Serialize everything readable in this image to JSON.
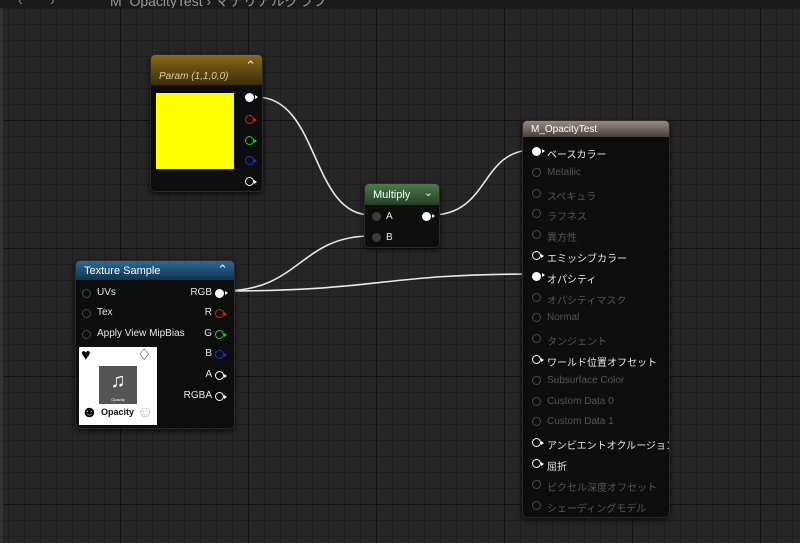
{
  "topbar": {
    "back": "‹",
    "forward": "›",
    "breadcrumb": "M_OpacityTest › マテリアルグラフ"
  },
  "param_node": {
    "title": "Param (1,1,0,0)",
    "color_hex": "#ffff00"
  },
  "multiply_node": {
    "title": "Multiply",
    "input_a": "A",
    "input_b": "B"
  },
  "texture_node": {
    "title": "Texture Sample",
    "inputs": [
      "UVs",
      "Tex",
      "Apply View MipBias"
    ],
    "outputs": [
      "RGB",
      "R",
      "G",
      "B",
      "A",
      "RGBA"
    ],
    "thumbnail_caption": "Opacity",
    "thumbnail_small": "Opacity"
  },
  "result_node": {
    "title": "M_OpacityTest",
    "pins": [
      {
        "label": "ベースカラー",
        "active": true
      },
      {
        "label": "Metallic",
        "active": false
      },
      {
        "label": "スペキュラ",
        "active": false
      },
      {
        "label": "ラフネス",
        "active": false
      },
      {
        "label": "異方性",
        "active": false
      },
      {
        "label": "エミッシブカラー",
        "active": true
      },
      {
        "label": "オパシティ",
        "active": true
      },
      {
        "label": "オパシティマスク",
        "active": false
      },
      {
        "label": "Normal",
        "active": false
      },
      {
        "label": "タンジェント",
        "active": false
      },
      {
        "label": "ワールド位置オフセット",
        "active": true
      },
      {
        "label": "Subsurface Color",
        "active": false
      },
      {
        "label": "Custom Data 0",
        "active": false
      },
      {
        "label": "Custom Data 1",
        "active": false
      },
      {
        "label": "アンビエントオクルージョン",
        "active": true
      },
      {
        "label": "屈折",
        "active": true
      },
      {
        "label": "ピクセル深度オフセット",
        "active": false
      },
      {
        "label": "シェーディングモデル",
        "active": false
      }
    ]
  },
  "colors": {
    "wire": "#e8e8e8",
    "param_header": "#8a6a18",
    "multiply_header": "#4a7a4a",
    "texture_header": "#2a6a9a",
    "result_header": "#9a8a80"
  }
}
